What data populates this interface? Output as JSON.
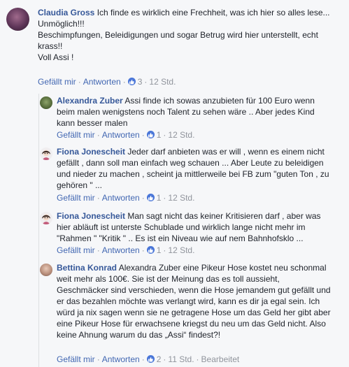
{
  "comments": [
    {
      "author": "Claudia Gross",
      "text": " Ich finde es wirklich eine Frechheit, was ich hier so alles lese...\nUnmöglich!!!\nBeschimpfungen, Beleidigungen und sogar Betrug wird hier unterstellt, echt krass!!\nVoll Assi !",
      "like_label": "Gefällt mir",
      "reply_label": "Antworten",
      "reaction_count": "3",
      "time": "12 Std."
    },
    {
      "author": "Alexandra Zuber",
      "text": " Assi finde ich sowas anzubieten für 100 Euro wenn beim malen wenigstens noch Talent zu sehen wäre .. Aber jedes Kind kann besser malen",
      "like_label": "Gefällt mir",
      "reply_label": "Antworten",
      "reaction_count": "1",
      "time": "12 Std."
    },
    {
      "author": "Fiona Jonescheit",
      "text": " Jeder darf anbieten was er will , wenn es einem nicht gefällt , dann soll man einfach weg schauen ... Aber Leute zu beleidigen und nieder zu machen , scheint ja mittlerweile bei FB zum \"guten Ton , zu gehören \" ...",
      "like_label": "Gefällt mir",
      "reply_label": "Antworten",
      "reaction_count": "1",
      "time": "12 Std."
    },
    {
      "author": "Fiona Jonescheit",
      "text": " Man sagt nicht das keiner Kritisieren darf , aber was hier abläuft ist unterste Schublade und wirklich lange nicht mehr im \"Rahmen \" \"Kritik \" .. Es ist ein Niveau wie auf nem Bahnhofsklo ...",
      "like_label": "Gefällt mir",
      "reply_label": "Antworten",
      "reaction_count": "1",
      "time": "12 Std."
    },
    {
      "author": "Bettina Konrad",
      "text": " Alexandra Zuber eine Pikeur Hose kostet neu schonmal weit mehr als 100€. Sie ist der Meinung das es toll aussieht, Geschmäcker sind verschieden, wenn die Hose jemandem gut gefällt und er das bezahlen möchte was verlangt wird, kann es dir ja egal sein. Ich würd ja nix sagen wenn sie ne getragene Hose um das Geld her gibt aber eine Pikeur Hose für erwachsene kriegst du neu um das Geld nicht. Also keine Ahnung warum du das „Assi“ findest?!",
      "like_label": "Gefällt mir",
      "reply_label": "Antworten",
      "reaction_count": "2",
      "time": "11 Std.",
      "edited_label": "Bearbeitet"
    }
  ],
  "colors": {
    "author": "#365899",
    "action_link": "#4267b2",
    "meta": "#90949c",
    "like_badge": "#4a76d8",
    "background": "#f6f7f9"
  },
  "icons": {
    "like": "thumbs-up-icon"
  }
}
